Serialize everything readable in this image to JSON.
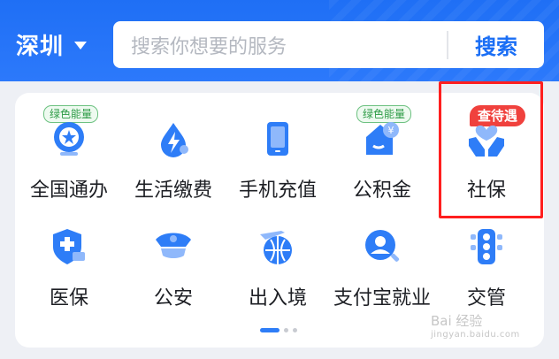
{
  "header": {
    "city": "深圳",
    "search_placeholder": "搜索你想要的服务",
    "search_button": "搜索"
  },
  "colors": {
    "primary": "#1f6ff5",
    "tag_green": "#2c9b45",
    "hot_red": "#f0413d",
    "highlight": "#ff1f1f"
  },
  "services": [
    {
      "label": "全国通办",
      "icon": "national-emblem-icon",
      "tag": "绿色能量"
    },
    {
      "label": "生活缴费",
      "icon": "water-drop-lightning-icon"
    },
    {
      "label": "手机充值",
      "icon": "mobile-phone-icon"
    },
    {
      "label": "公积金",
      "icon": "house-yuan-icon",
      "tag": "绿色能量"
    },
    {
      "label": "社保",
      "icon": "hands-heart-icon",
      "badge": "查待遇"
    },
    {
      "label": "医保",
      "icon": "shield-card-icon"
    },
    {
      "label": "公安",
      "icon": "police-cap-icon"
    },
    {
      "label": "出入境",
      "icon": "globe-airplane-icon"
    },
    {
      "label": "支付宝就业",
      "icon": "person-search-icon"
    },
    {
      "label": "交管",
      "icon": "traffic-light-icon"
    }
  ],
  "pager": {
    "current": 1,
    "total": 3
  },
  "watermark": {
    "text": "Bai 经验",
    "sub": "jingyan.baidu.com"
  }
}
